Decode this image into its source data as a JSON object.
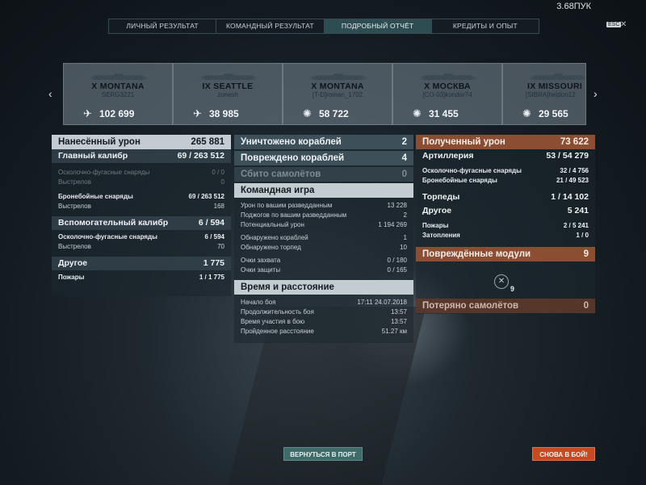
{
  "currency": "3.68ПУК",
  "tabs": [
    "ЛИЧНЫЙ РЕЗУЛЬТАТ",
    "КОМАНДНЫЙ РЕЗУЛЬТАТ",
    "ПОДРОБНЫЙ ОТЧЁТ",
    "КРЕДИТЫ И ОПЫТ"
  ],
  "esc_label": "ESC",
  "cards": [
    {
      "ship": "X MONTANA",
      "player": "SERG3221",
      "damage": "102 699"
    },
    {
      "ship": "IX SEATTLE",
      "player": "zonesh",
      "damage": "38 985"
    },
    {
      "ship": "X MONTANA",
      "player": "[T-D]roman_1702",
      "damage": "58 722"
    },
    {
      "ship": "X МОСКВА",
      "player": "[CO-03]kondor74",
      "damage": "31 455"
    },
    {
      "ship": "IX MISSOURI",
      "player": "[SIBRA]he|don12",
      "damage": "29 565"
    }
  ],
  "left": {
    "header": {
      "label": "Нанесённый урон",
      "value": "265 881"
    },
    "main_caliber": {
      "label": "Главный калибр",
      "value_a": "69",
      "value_b": "263 512"
    },
    "he": {
      "label": "Осколочно-фугасные снаряды",
      "a": "0",
      "b": "0"
    },
    "he_shots": {
      "label": "Выстрелов",
      "value": "0"
    },
    "ap": {
      "label": "Бронебойные снаряды",
      "a": "69",
      "b": "263 512"
    },
    "ap_shots": {
      "label": "Выстрелов",
      "value": "168"
    },
    "secondary": {
      "label": "Вспомогательный калибр",
      "value_a": "6",
      "value_b": "594"
    },
    "sec_he": {
      "label": "Осколочно-фугасные снаряды",
      "a": "6",
      "b": "594"
    },
    "sec_shots": {
      "label": "Выстрелов",
      "value": "70"
    },
    "other": {
      "label": "Другое",
      "value": "1 775"
    },
    "fires": {
      "label": "Пожары",
      "a": "1",
      "b": "1 775"
    }
  },
  "middle": {
    "destroyed": {
      "label": "Уничтожено кораблей",
      "value": "2"
    },
    "damaged": {
      "label": "Повреждено кораблей",
      "value": "4"
    },
    "planes": {
      "label": "Сбито самолётов",
      "value": "0"
    },
    "team": {
      "header": "Командная игра",
      "rows": [
        {
          "label": "Урон по вашим разведданным",
          "value": "13 228"
        },
        {
          "label": "Поджогов по вашим разведданным",
          "value": "2"
        },
        {
          "label": "Потенциальный урон",
          "value": "1 194 269"
        },
        {
          "label": "Обнаружено кораблей",
          "value": "1"
        },
        {
          "label": "Обнаружено торпед",
          "value": "10"
        },
        {
          "label": "Очки захвата",
          "value": "0 / 180"
        },
        {
          "label": "Очки защиты",
          "value": "0 / 165"
        }
      ]
    },
    "time": {
      "header": "Время и расстояние",
      "rows": [
        {
          "label": "Начало боя",
          "value": "17:11  24.07.2018"
        },
        {
          "label": "Продолжительность боя",
          "value": "13:57"
        },
        {
          "label": "Время участия в бою",
          "value": "13:57"
        },
        {
          "label": "Пройденное расстояние",
          "value": "51.27 км"
        }
      ]
    }
  },
  "right": {
    "header": {
      "label": "Полученный урон",
      "value": "73 622"
    },
    "artillery": {
      "label": "Артиллерия",
      "a": "53",
      "b": "54 279"
    },
    "he": {
      "label": "Осколочно-фугасные снаряды",
      "a": "32",
      "b": "4 756"
    },
    "ap": {
      "label": "Бронебойные снаряды",
      "a": "21",
      "b": "49 523"
    },
    "torpedoes": {
      "label": "Торпеды",
      "a": "1",
      "b": "14 102"
    },
    "other": {
      "label": "Другое",
      "value": "5 241"
    },
    "fires": {
      "label": "Пожары",
      "a": "2",
      "b": "5 241"
    },
    "flooding": {
      "label": "Затопления",
      "a": "1",
      "b": "0"
    },
    "modules": {
      "label": "Повреждённые модули",
      "value": "9",
      "count": "9"
    },
    "planes_lost": {
      "label": "Потеряно самолётов",
      "value": "0"
    }
  },
  "buttons": {
    "port": "ВЕРНУТЬСЯ В ПОРТ",
    "battle": "СНОВА В БОЙ!"
  },
  "colors": {
    "accent_orange": "#c64a21",
    "accent_teal": "#3f6b6b",
    "received_header": "#8c4e32"
  }
}
